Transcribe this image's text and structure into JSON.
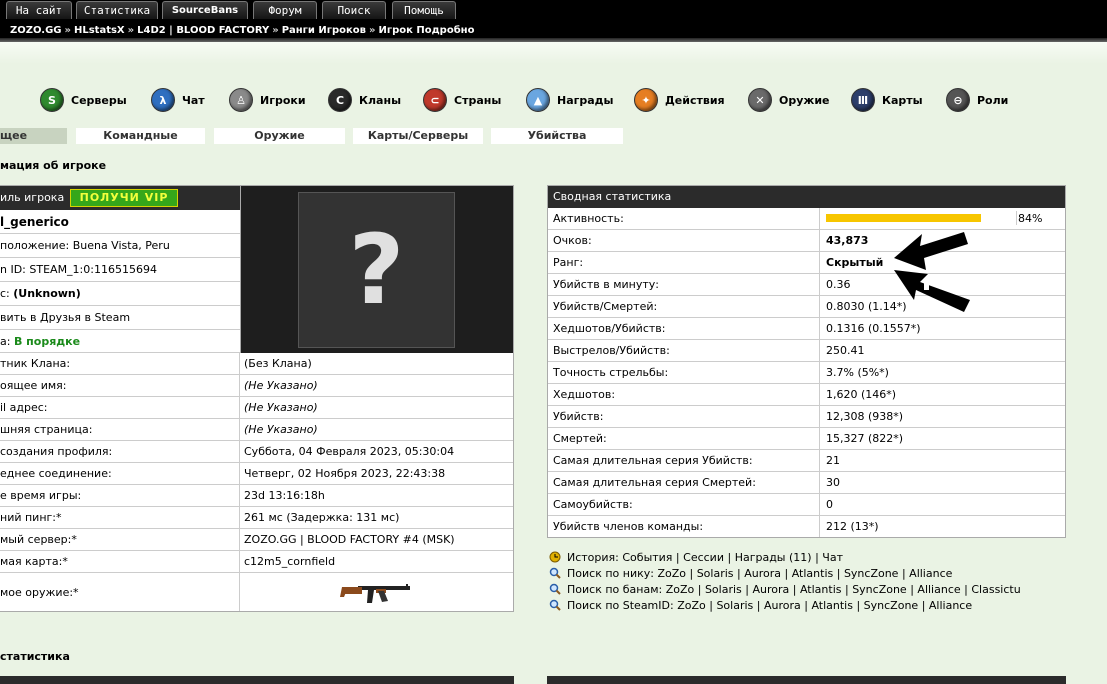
{
  "top_tabs": [
    "На сайт",
    "Статистика",
    "SourceBans",
    "Форум",
    "Поиск",
    "Помощь"
  ],
  "breadcrumb": [
    "ZOZO.GG",
    "HLstatsX",
    "L4D2 | BLOOD FACTORY",
    "Ранги Игроков",
    "Игрок Подробно"
  ],
  "breadcrumb_sep": "»",
  "nav": [
    {
      "label": "Серверы",
      "icon": "servers-icon",
      "color": "#2f8a2f",
      "glyph": "S"
    },
    {
      "label": "Чат",
      "icon": "chat-icon",
      "color": "#2f6fc0",
      "glyph": "λ"
    },
    {
      "label": "Игроки",
      "icon": "players-icon",
      "color": "#8a8a8a",
      "glyph": "♙"
    },
    {
      "label": "Кланы",
      "icon": "clans-icon",
      "color": "#2a2a2a",
      "glyph": "C"
    },
    {
      "label": "Страны",
      "icon": "countries-icon",
      "color": "#c0392b",
      "glyph": "⊂"
    },
    {
      "label": "Награды",
      "icon": "awards-icon",
      "color": "#6aa6e0",
      "glyph": "▲"
    },
    {
      "label": "Действия",
      "icon": "actions-icon",
      "color": "#e67e22",
      "glyph": "✦"
    },
    {
      "label": "Оружие",
      "icon": "weapons-icon",
      "color": "#6a6a6a",
      "glyph": "✕"
    },
    {
      "label": "Карты",
      "icon": "maps-icon",
      "color": "#2c3e6b",
      "glyph": "Ⅲ"
    },
    {
      "label": "Роли",
      "icon": "roles-icon",
      "color": "#555555",
      "glyph": "⊖"
    }
  ],
  "sub_tabs": [
    "щее",
    "Командные",
    "Оружие",
    "Карты/Серверы",
    "Убийства"
  ],
  "section_title": "мация об игроке",
  "bottom_section_title": "статистика",
  "profile": {
    "header": "иль игрока",
    "vip": "ПОЛУЧИ VIP",
    "name": "l_generico",
    "location_label": "положение:",
    "location_value": "Buena Vista, Peru",
    "steam_label": "n ID:",
    "steam_value": "STEAM_1:0:116515694",
    "status_label": "с:",
    "status_value": "(Unknown)",
    "friend": "вить в Друзья в Steam",
    "state_label": "а:",
    "state_value": "В порядке",
    "avatar_glyph": "?"
  },
  "details": [
    {
      "label": "тник Клана:",
      "value": "(Без Клана)",
      "italic": false
    },
    {
      "label": "оящее имя:",
      "value": "(Не Указано)",
      "italic": true
    },
    {
      "label": "il адрес:",
      "value": "(Не Указано)",
      "italic": true
    },
    {
      "label": "шняя страница:",
      "value": "(Не Указано)",
      "italic": true
    },
    {
      "label": "создания профиля:",
      "value": "Суббота, 04 Февраля 2023, 05:30:04",
      "italic": false
    },
    {
      "label": "еднее соединение:",
      "value": "Четверг, 02 Ноября 2023, 22:43:38",
      "italic": false
    },
    {
      "label": "е время игры:",
      "value": "23d 13:16:18h",
      "italic": false
    },
    {
      "label": "ний пинг:*",
      "value": "261 мс (Задержка: 131 мс)",
      "italic": false
    },
    {
      "label": "мый сервер:*",
      "value": "ZOZO.GG | BLOOD FACTORY #4 (MSK)",
      "italic": false
    },
    {
      "label": "мая карта:*",
      "value": "c12m5_cornfield",
      "italic": false
    },
    {
      "label": "мое оружие:*",
      "value": "",
      "italic": false
    }
  ],
  "summary": {
    "header": "Сводная статистика",
    "activity_label": "Активность:",
    "activity_percent": "84%",
    "activity_value": 84,
    "bar_color": "#f7c600",
    "rows": [
      {
        "label": "Очков:",
        "value": "43,873",
        "bold": true
      },
      {
        "label": "Ранг:",
        "value": "Скрытый",
        "bold": true
      },
      {
        "label": "Убийств в минуту:",
        "value": "0.36",
        "bold": false
      },
      {
        "label": "Убийств/Смертей:",
        "value": "0.8030 (1.14*)",
        "bold": false
      },
      {
        "label": "Хедшотов/Убийств:",
        "value": "0.1316 (0.1557*)",
        "bold": false
      },
      {
        "label": "Выстрелов/Убийств:",
        "value": "250.41",
        "bold": false
      },
      {
        "label": "Точность стрельбы:",
        "value": "3.7% (5%*)",
        "bold": false
      },
      {
        "label": "Хедшотов:",
        "value": "1,620 (146*)",
        "bold": false
      },
      {
        "label": "Убийств:",
        "value": "12,308 (938*)",
        "bold": false
      },
      {
        "label": "Смертей:",
        "value": "15,327 (822*)",
        "bold": false
      },
      {
        "label": "Самая длительная серия Убийств:",
        "value": "21",
        "bold": false
      },
      {
        "label": "Самая длительная серия Смертей:",
        "value": "30",
        "bold": false
      },
      {
        "label": "Самоубийств:",
        "value": "0",
        "bold": false
      },
      {
        "label": "Убийств членов команды:",
        "value": "212 (13*)",
        "bold": false
      }
    ]
  },
  "links": [
    {
      "icon": "history-icon",
      "label": "История:",
      "items": [
        "События",
        "Сессии",
        "Награды (11)",
        "Чат"
      ]
    },
    {
      "icon": "magnifier-icon",
      "label": "Поиск по нику:",
      "items": [
        "ZoZo",
        "Solaris",
        "Aurora",
        "Atlantis",
        "SyncZone",
        "Alliance"
      ]
    },
    {
      "icon": "magnifier-icon",
      "label": "Поиск по банам:",
      "items": [
        "ZoZo",
        "Solaris",
        "Aurora",
        "Atlantis",
        "SyncZone",
        "Alliance",
        "Classictu"
      ]
    },
    {
      "icon": "magnifier-icon",
      "label": "Поиск по SteamID:",
      "items": [
        "ZoZo",
        "Solaris",
        "Aurora",
        "Atlantis",
        "SyncZone",
        "Alliance"
      ]
    }
  ]
}
